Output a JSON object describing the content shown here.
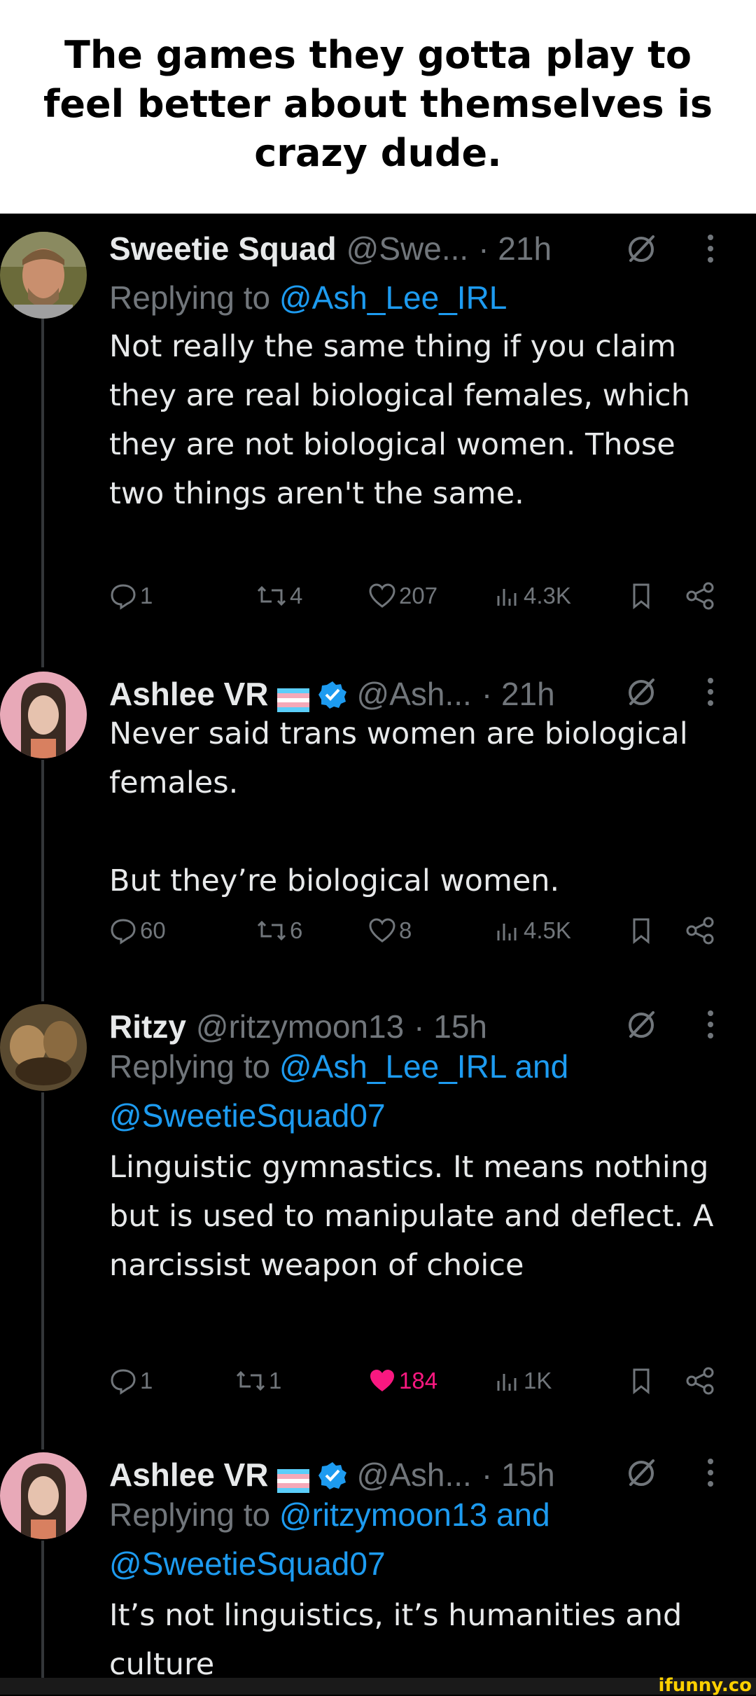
{
  "caption": "The games they gotta play to feel better about themselves is crazy dude.",
  "tweets": [
    {
      "name": "Sweetie Squad",
      "handle": "@Swe...",
      "time": "· 21h",
      "replying_label": "Replying to",
      "replying_to": "@Ash_Lee_IRL",
      "text": "Not really the same thing if you claim they are real biological females, which they are not biological women. Those two things aren't the same.",
      "stats": {
        "replies": "1",
        "reposts": "4",
        "likes": "207",
        "views": "4.3K"
      }
    },
    {
      "name": "Ashlee VR",
      "handle": "@Ash...",
      "time": "· 21h",
      "text": "Never said trans women are biological females.\n\nBut they’re biological women.",
      "stats": {
        "replies": "60",
        "reposts": "6",
        "likes": "8",
        "views": "4.5K"
      }
    },
    {
      "name": "Ritzy",
      "handle": "@ritzymoon13",
      "time": "· 15h",
      "replying_label": "Replying to",
      "replying_to": "@Ash_Lee_IRL",
      "replying_and": "and",
      "replying_to_2": "@SweetieSquad07",
      "text": "Linguistic gymnastics. It means nothing but is used to manipulate and deflect. A narcissist weapon of choice",
      "stats": {
        "replies": "1",
        "reposts": "1",
        "likes": "184",
        "views": "1K"
      }
    },
    {
      "name": "Ashlee VR",
      "handle": "@Ash...",
      "time": "· 15h",
      "replying_label": "Replying to",
      "replying_to": "@ritzymoon13",
      "replying_and": "and",
      "replying_to_2": "@SweetieSquad07",
      "text": "It’s not linguistics, it’s humanities and culture"
    }
  ],
  "watermark": "ifunny.co",
  "colors": {
    "background": "#000000",
    "text": "#e7e9ea",
    "muted": "#71767b",
    "link": "#1d9bf0",
    "like": "#f91880"
  }
}
